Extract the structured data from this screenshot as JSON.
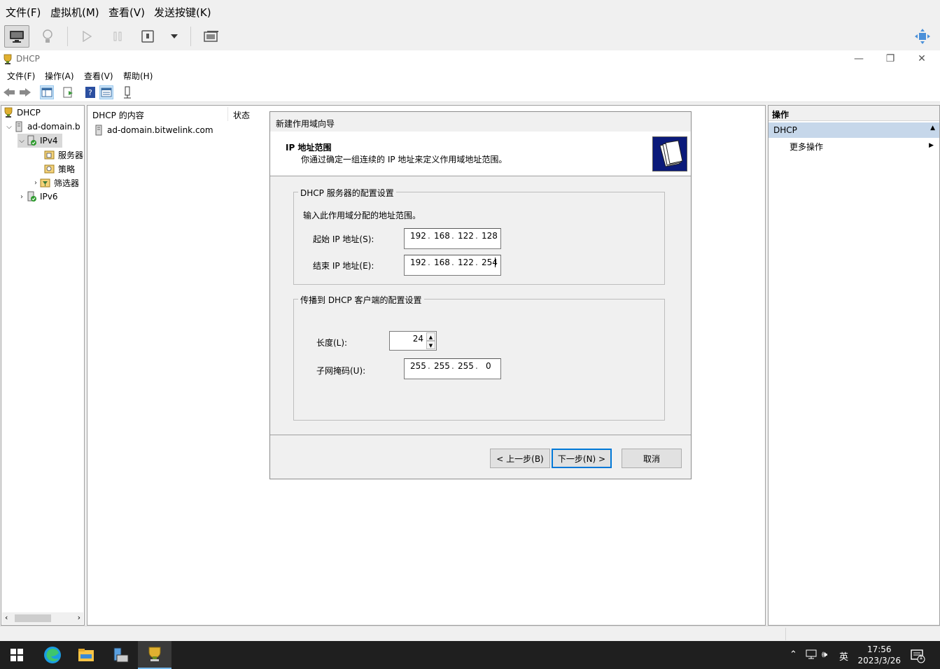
{
  "vm_menu": [
    "文件(F)",
    "虚拟机(M)",
    "查看(V)",
    "发送按键(K)"
  ],
  "window": {
    "title": "DHCP"
  },
  "mmc_menu": [
    "文件(F)",
    "操作(A)",
    "查看(V)",
    "帮助(H)"
  ],
  "tree": {
    "root": "DHCP",
    "server": "ad-domain.b",
    "ipv4": "IPv4",
    "options": "服务器",
    "policies": "策略",
    "filters": "筛选器",
    "ipv6": "IPv6"
  },
  "content": {
    "col_name": "DHCP 的内容",
    "col_status": "状态",
    "row_name": "ad-domain.bitwelink.com"
  },
  "actions": {
    "header": "操作",
    "selected": "DHCP",
    "more": "更多操作"
  },
  "wizard": {
    "title": "新建作用域向导",
    "heading": "IP 地址范围",
    "subtitle": "你通过确定一组连续的 IP 地址来定义作用域地址范围。",
    "group1": "DHCP 服务器的配置设置",
    "instruction": "输入此作用域分配的地址范围。",
    "start_label": "起始 IP 地址(S):",
    "start_ip": [
      "192",
      "168",
      "122",
      "128"
    ],
    "end_label": "结束 IP 地址(E):",
    "end_ip": [
      "192",
      "168",
      "122",
      "254"
    ],
    "group2": "传播到 DHCP 客户端的配置设置",
    "length_label": "长度(L):",
    "length_value": "24",
    "mask_label": "子网掩码(U):",
    "mask": [
      "255",
      "255",
      "255",
      "0"
    ],
    "back": "< 上一步(B)",
    "next": "下一步(N) >",
    "cancel": "取消"
  },
  "taskbar": {
    "time": "17:56",
    "date": "2023/3/26",
    "ime": "英",
    "notifications": "1"
  },
  "colors": {
    "accent": "#0078d7",
    "selection": "#cce4f7",
    "wizard_logo": "#0b1a7a",
    "taskbar": "#1f1f1f"
  }
}
